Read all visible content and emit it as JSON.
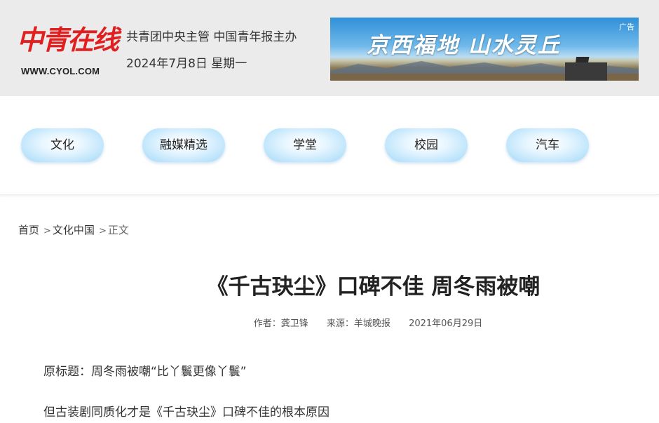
{
  "header": {
    "logo_text": "中青在线",
    "logo_url": "WWW.CYOL.COM",
    "org": "共青团中央主管  中国青年报主办",
    "date": "2024年7月8日  星期一"
  },
  "ad": {
    "tag": "广告",
    "headline": "京西福地 山水灵丘"
  },
  "nav": {
    "items": [
      {
        "label": "文化"
      },
      {
        "label": "融媒精选"
      },
      {
        "label": "学堂"
      },
      {
        "label": "校园"
      },
      {
        "label": "汽车"
      }
    ]
  },
  "breadcrumb": {
    "home": "首页",
    "sep": ">",
    "section": "文化中国",
    "current": "正文"
  },
  "article": {
    "title": "《千古玦尘》口碑不佳 周冬雨被嘲",
    "author": "作者：龚卫锋",
    "source": "来源：羊城晚报",
    "date": "2021年06月29日",
    "paragraphs": [
      "原标题：周冬雨被嘲“比丫鬟更像丫鬟”",
      "但古装剧同质化才是《千古玦尘》口碑不佳的根本原因"
    ]
  },
  "colors": {
    "logo_red": "#e02020",
    "header_bg": "#ebebeb",
    "nav_pill": "#b8e2fb"
  }
}
